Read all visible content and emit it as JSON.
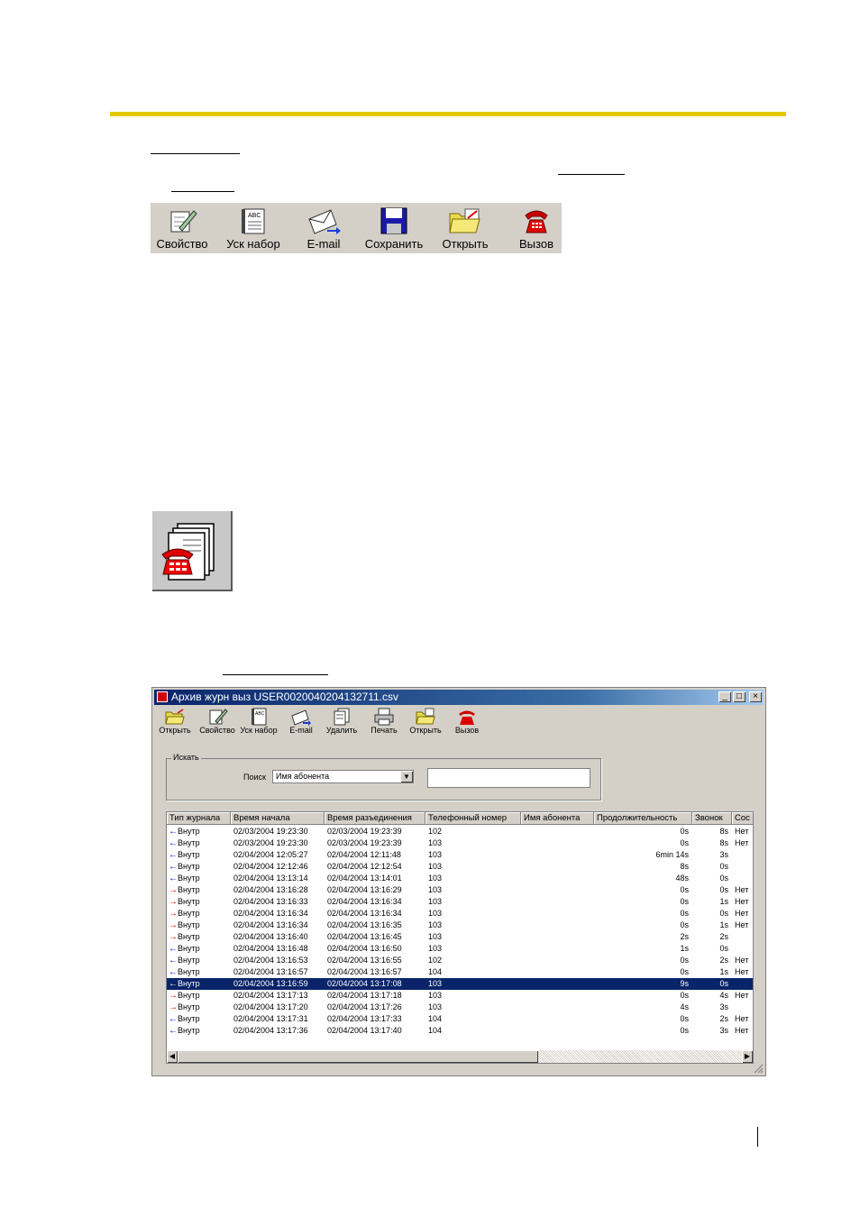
{
  "toolbar1": {
    "buttons": [
      {
        "label": "Свойство",
        "icon": "property-icon"
      },
      {
        "label": "Уск набор",
        "icon": "speed-dial-icon"
      },
      {
        "label": "E-mail",
        "icon": "email-icon"
      },
      {
        "label": "Сохранить",
        "icon": "save-icon"
      },
      {
        "label": "Открыть",
        "icon": "open-folder-icon"
      },
      {
        "label": "Вызов",
        "icon": "phone-icon"
      }
    ]
  },
  "window": {
    "title": "Архив журн выз USER0020040204132711.csv",
    "controls": {
      "minimize": "_",
      "maximize": "□",
      "close": "×"
    },
    "toolbar": [
      {
        "label": "Открыть",
        "icon": "open-folder-icon"
      },
      {
        "label": "Свойство",
        "icon": "property-icon"
      },
      {
        "label": "Уск набор",
        "icon": "speed-dial-icon"
      },
      {
        "label": "E-mail",
        "icon": "email-icon"
      },
      {
        "label": "Удалить",
        "icon": "delete-icon"
      },
      {
        "label": "Печать",
        "icon": "printer-icon"
      },
      {
        "label": "Открыть",
        "icon": "open-folder-icon"
      },
      {
        "label": "Вызов",
        "icon": "phone-icon"
      }
    ],
    "search": {
      "group_label": "Искать",
      "field_label": "Поиск",
      "selected": "Имя абонента",
      "text_value": ""
    },
    "table": {
      "columns": [
        "Тип журнала",
        "Время начала",
        "Время разъединения",
        "Телефонный номер",
        "Имя абонента",
        "Продолжительность",
        "Звонок",
        "Сос"
      ],
      "rows": [
        {
          "dir": "in",
          "type": "Внутр",
          "start": "02/03/2004 19:23:30",
          "end": "02/03/2004 19:23:39",
          "number": "102",
          "name": "",
          "duration": "0s",
          "ring": "8s",
          "status": "Нет"
        },
        {
          "dir": "in",
          "type": "Внутр",
          "start": "02/03/2004 19:23:30",
          "end": "02/03/2004 19:23:39",
          "number": "103",
          "name": "",
          "duration": "0s",
          "ring": "8s",
          "status": "Нет"
        },
        {
          "dir": "in",
          "type": "Внутр",
          "start": "02/04/2004 12:05:27",
          "end": "02/04/2004 12:11:48",
          "number": "103",
          "name": "",
          "duration": "6min 14s",
          "ring": "3s",
          "status": ""
        },
        {
          "dir": "in",
          "type": "Внутр",
          "start": "02/04/2004 12:12:46",
          "end": "02/04/2004 12:12:54",
          "number": "103",
          "name": "",
          "duration": "8s",
          "ring": "0s",
          "status": ""
        },
        {
          "dir": "in",
          "type": "Внутр",
          "start": "02/04/2004 13:13:14",
          "end": "02/04/2004 13:14:01",
          "number": "103",
          "name": "",
          "duration": "48s",
          "ring": "0s",
          "status": ""
        },
        {
          "dir": "out",
          "type": "Внутр",
          "start": "02/04/2004 13:16:28",
          "end": "02/04/2004 13:16:29",
          "number": "103",
          "name": "",
          "duration": "0s",
          "ring": "0s",
          "status": "Нет"
        },
        {
          "dir": "out",
          "type": "Внутр",
          "start": "02/04/2004 13:16:33",
          "end": "02/04/2004 13:16:34",
          "number": "103",
          "name": "",
          "duration": "0s",
          "ring": "1s",
          "status": "Нет"
        },
        {
          "dir": "out",
          "type": "Внутр",
          "start": "02/04/2004 13:16:34",
          "end": "02/04/2004 13:16:34",
          "number": "103",
          "name": "",
          "duration": "0s",
          "ring": "0s",
          "status": "Нет"
        },
        {
          "dir": "out",
          "type": "Внутр",
          "start": "02/04/2004 13:16:34",
          "end": "02/04/2004 13:16:35",
          "number": "103",
          "name": "",
          "duration": "0s",
          "ring": "1s",
          "status": "Нет"
        },
        {
          "dir": "out",
          "type": "Внутр",
          "start": "02/04/2004 13:16:40",
          "end": "02/04/2004 13:16:45",
          "number": "103",
          "name": "",
          "duration": "2s",
          "ring": "2s",
          "status": ""
        },
        {
          "dir": "in",
          "type": "Внутр",
          "start": "02/04/2004 13:16:48",
          "end": "02/04/2004 13:16:50",
          "number": "103",
          "name": "",
          "duration": "1s",
          "ring": "0s",
          "status": ""
        },
        {
          "dir": "in",
          "type": "Внутр",
          "start": "02/04/2004 13:16:53",
          "end": "02/04/2004 13:16:55",
          "number": "102",
          "name": "",
          "duration": "0s",
          "ring": "2s",
          "status": "Нет"
        },
        {
          "dir": "in",
          "type": "Внутр",
          "start": "02/04/2004 13:16:57",
          "end": "02/04/2004 13:16:57",
          "number": "104",
          "name": "",
          "duration": "0s",
          "ring": "1s",
          "status": "Нет"
        },
        {
          "dir": "in",
          "type": "Внутр",
          "start": "02/04/2004 13:16:59",
          "end": "02/04/2004 13:17:08",
          "number": "103",
          "name": "",
          "duration": "9s",
          "ring": "0s",
          "status": "",
          "selected": true
        },
        {
          "dir": "out",
          "type": "Внутр",
          "start": "02/04/2004 13:17:13",
          "end": "02/04/2004 13:17:18",
          "number": "103",
          "name": "",
          "duration": "0s",
          "ring": "4s",
          "status": "Нет"
        },
        {
          "dir": "out",
          "type": "Внутр",
          "start": "02/04/2004 13:17:20",
          "end": "02/04/2004 13:17:26",
          "number": "103",
          "name": "",
          "duration": "4s",
          "ring": "3s",
          "status": ""
        },
        {
          "dir": "in",
          "type": "Внутр",
          "start": "02/04/2004 13:17:31",
          "end": "02/04/2004 13:17:33",
          "number": "104",
          "name": "",
          "duration": "0s",
          "ring": "2s",
          "status": "Нет"
        },
        {
          "dir": "in",
          "type": "Внутр",
          "start": "02/04/2004 13:17:36",
          "end": "02/04/2004 13:17:40",
          "number": "104",
          "name": "",
          "duration": "0s",
          "ring": "3s",
          "status": "Нет"
        }
      ],
      "arrow_colors": {
        "in": "#0000cc",
        "out": "#e00000"
      },
      "selection_color": "#0a246a"
    }
  },
  "colors": {
    "rule": "#e6c800",
    "dialog": "#d4d0c8"
  }
}
